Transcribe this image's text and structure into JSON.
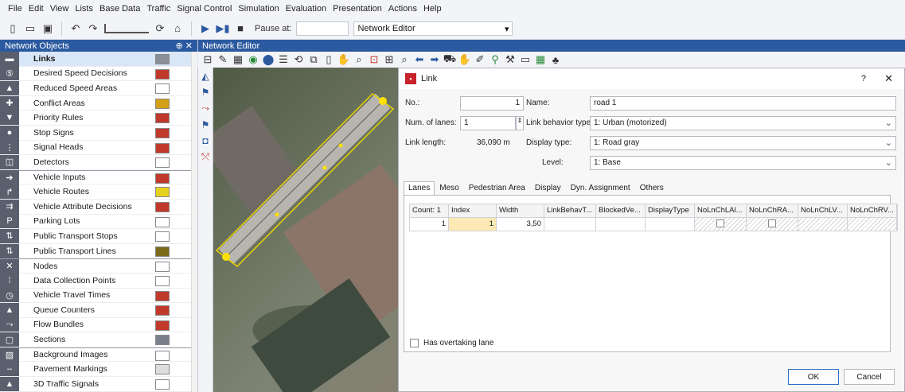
{
  "menu": [
    "File",
    "Edit",
    "View",
    "Lists",
    "Base Data",
    "Traffic",
    "Signal Control",
    "Simulation",
    "Evaluation",
    "Presentation",
    "Actions",
    "Help"
  ],
  "toolbar": {
    "pause_label": "Pause at:",
    "view_select": "Network Editor"
  },
  "panel": {
    "title": "Network Objects",
    "pin": "⊕ ✕",
    "items": [
      {
        "label": "Links",
        "icon": "links-icon",
        "glyph": "▬"
      },
      {
        "label": "Desired Speed Decisions",
        "icon": "speed-sign-icon",
        "glyph": "⑤"
      },
      {
        "label": "Reduced Speed Areas",
        "icon": "warning-triangle-icon",
        "glyph": "▲"
      },
      {
        "label": "Conflict Areas",
        "icon": "conflict-icon",
        "glyph": "✚"
      },
      {
        "label": "Priority Rules",
        "icon": "priority-icon",
        "glyph": "▼"
      },
      {
        "label": "Stop Signs",
        "icon": "stop-icon",
        "glyph": "●"
      },
      {
        "label": "Signal Heads",
        "icon": "traffic-light-icon",
        "glyph": "⋮"
      },
      {
        "label": "Detectors",
        "icon": "detector-icon",
        "glyph": "◫"
      },
      {
        "label": "Vehicle Inputs",
        "icon": "vehicle-input-icon",
        "glyph": "➔"
      },
      {
        "label": "Vehicle Routes",
        "icon": "route-icon",
        "glyph": "↱"
      },
      {
        "label": "Vehicle Attribute Decisions",
        "icon": "attribute-decision-icon",
        "glyph": "⇉"
      },
      {
        "label": "Parking Lots",
        "icon": "parking-icon",
        "glyph": "P"
      },
      {
        "label": "Public Transport Stops",
        "icon": "pt-stop-icon",
        "glyph": "⇅"
      },
      {
        "label": "Public Transport Lines",
        "icon": "pt-line-icon",
        "glyph": "⇅"
      },
      {
        "label": "Nodes",
        "icon": "node-icon",
        "glyph": "✕"
      },
      {
        "label": "Data Collection Points",
        "icon": "data-point-icon",
        "glyph": "⁞"
      },
      {
        "label": "Vehicle Travel Times",
        "icon": "stopwatch-icon",
        "glyph": "◷"
      },
      {
        "label": "Queue Counters",
        "icon": "queue-icon",
        "glyph": "▲"
      },
      {
        "label": "Flow Bundles",
        "icon": "flow-icon",
        "glyph": "⤳"
      },
      {
        "label": "Sections",
        "icon": "section-icon",
        "glyph": "▢"
      },
      {
        "label": "Background Images",
        "icon": "image-icon",
        "glyph": "▨"
      },
      {
        "label": "Pavement Markings",
        "icon": "marking-icon",
        "glyph": "╌"
      },
      {
        "label": "3D Traffic Signals",
        "icon": "signal-3d-icon",
        "glyph": "▲"
      }
    ],
    "swatch_colors": [
      "#8a8f99",
      "#c0392b",
      "#ffffff",
      "#d4a017",
      "#c0392b",
      "#c0392b",
      "#c0392b",
      "#ffffff",
      "#c0392b",
      "#e6d21e",
      "#c0392b",
      "#ffffff",
      "#ffffff",
      "#7a6a1a",
      "#ffffff",
      "#ffffff",
      "#c0392b",
      "#c0392b",
      "#c0392b",
      "#7a7f8c",
      "#ffffff",
      "#dddddd",
      "#ffffff"
    ]
  },
  "editor": {
    "title": "Network Editor"
  },
  "dialog": {
    "title": "Link",
    "help": "?",
    "close": "✕",
    "no_label": "No.:",
    "no_value": "1",
    "name_label": "Name:",
    "name_value": "road 1",
    "lanes_label": "Num. of lanes:",
    "lanes_value": "1",
    "behavior_label": "Link behavior type:",
    "behavior_value": "1: Urban (motorized)",
    "length_label": "Link length:",
    "length_value": "36,090 m",
    "display_label": "Display type:",
    "display_value": "1: Road gray",
    "level_label": "Level:",
    "level_value": "1: Base",
    "tabs": [
      "Lanes",
      "Meso",
      "Pedestrian Area",
      "Display",
      "Dyn. Assignment",
      "Others"
    ],
    "grid": {
      "headers": [
        "Count: 1",
        "Index",
        "Width",
        "LinkBehavT...",
        "BlockedVe...",
        "DisplayType",
        "NoLnChLAl...",
        "NoLnChRA...",
        "NoLnChLV...",
        "NoLnChRV..."
      ],
      "row": [
        "1",
        "1",
        "3,50",
        "",
        "",
        "",
        "",
        "",
        "",
        ""
      ]
    },
    "overtaking_label": "Has overtaking lane",
    "ok": "OK",
    "cancel": "Cancel"
  }
}
